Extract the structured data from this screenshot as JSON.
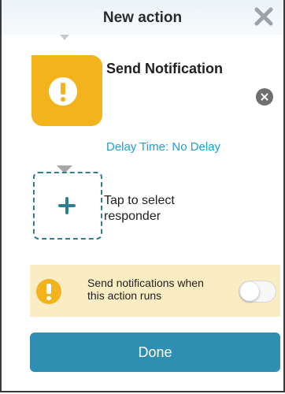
{
  "header": {
    "title": "New action",
    "close_icon": "close-x-icon"
  },
  "action": {
    "icon": "exclamation-icon",
    "name": "Send Notification",
    "delay": "Delay Time: No Delay",
    "remove_icon": "remove-circle-icon",
    "tile_color": "#f3b31d"
  },
  "responder": {
    "icon": "plus-icon",
    "label": "Tap to select responder"
  },
  "notify_banner": {
    "icon": "exclamation-icon",
    "text": "Send notifications when this action runs",
    "toggle_on": false
  },
  "footer": {
    "done_label": "Done",
    "accent": "#2e8fb2"
  }
}
